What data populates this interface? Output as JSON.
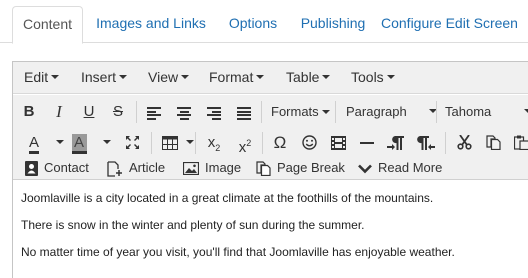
{
  "tabs": [
    {
      "label": "Content",
      "active": true
    },
    {
      "label": "Images and Links"
    },
    {
      "label": "Options"
    },
    {
      "label": "Publishing"
    },
    {
      "label": "Configure Edit Screen"
    }
  ],
  "menubar": [
    "Edit",
    "Insert",
    "View",
    "Format",
    "Table",
    "Tools"
  ],
  "toolbar": {
    "bold": "B",
    "italic": "I",
    "underline": "U",
    "strike": "S",
    "formats": "Formats",
    "paragraph": "Paragraph",
    "font": "Tahoma",
    "font_color": "A",
    "bg_color": "A",
    "subscript": "x",
    "subscript_mark": "2",
    "superscript": "x",
    "superscript_mark": "2",
    "special_char": "Ω"
  },
  "insert_buttons": {
    "contact": "Contact",
    "article": "Article",
    "image": "Image",
    "page_break": "Page Break",
    "read_more": "Read More"
  },
  "content": [
    "Joomlaville is a city located in a great climate at the foothills of the mountains.",
    "There is snow in the winter and plenty of sun during the summer.",
    "No matter time of year you visit, you'll find that Joomlaville has enjoyable weather."
  ]
}
